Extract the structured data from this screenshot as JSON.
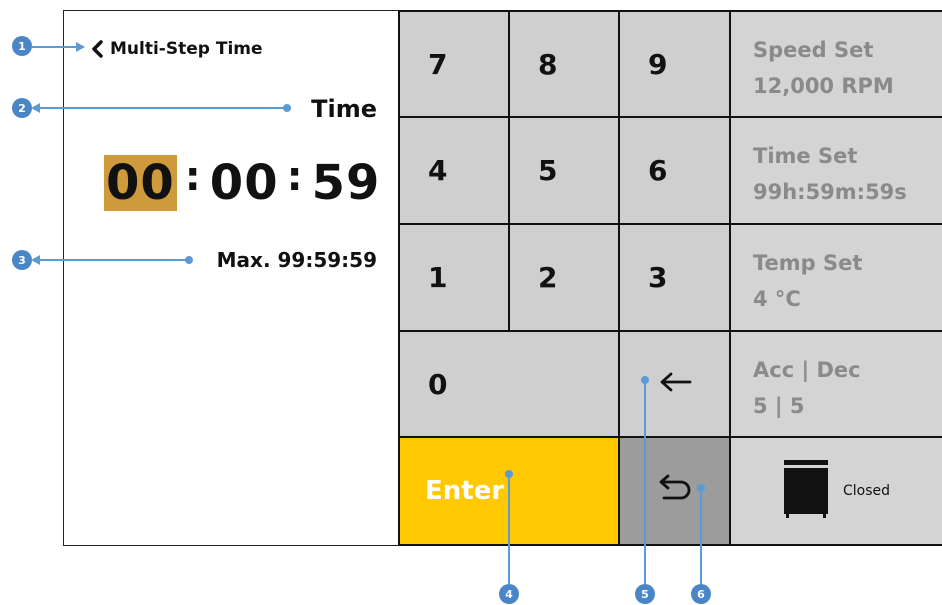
{
  "header": {
    "back_label": "Multi-Step Time"
  },
  "time_entry": {
    "label": "Time",
    "hours": "00",
    "minutes": "00",
    "seconds": "59",
    "separator": ":",
    "max_label": "Max. 99:59:59"
  },
  "keypad": {
    "keys": [
      "7",
      "8",
      "9",
      "4",
      "5",
      "6",
      "1",
      "2",
      "3",
      "0"
    ],
    "enter_label": "Enter",
    "backspace_icon": "left-arrow-icon",
    "undo_icon": "undo-icon"
  },
  "status": {
    "speed": {
      "title": "Speed Set",
      "value": "12,000 RPM"
    },
    "time": {
      "title": "Time Set",
      "value": "99h:59m:59s"
    },
    "temp": {
      "title": "Temp Set",
      "value": "4 °C"
    },
    "accdec": {
      "title": "Acc | Dec",
      "value": "5 | 5"
    },
    "lid": {
      "label": "Closed",
      "icon": "lid-closed-icon"
    }
  },
  "callouts": [
    "1",
    "2",
    "3",
    "4",
    "5",
    "6"
  ],
  "colors": {
    "accent_yellow": "#ffc800",
    "highlight": "#cf9a3c",
    "key_gray": "#cfcfcf",
    "undo_gray": "#9c9c9c",
    "callout_blue": "#4a86c7"
  }
}
